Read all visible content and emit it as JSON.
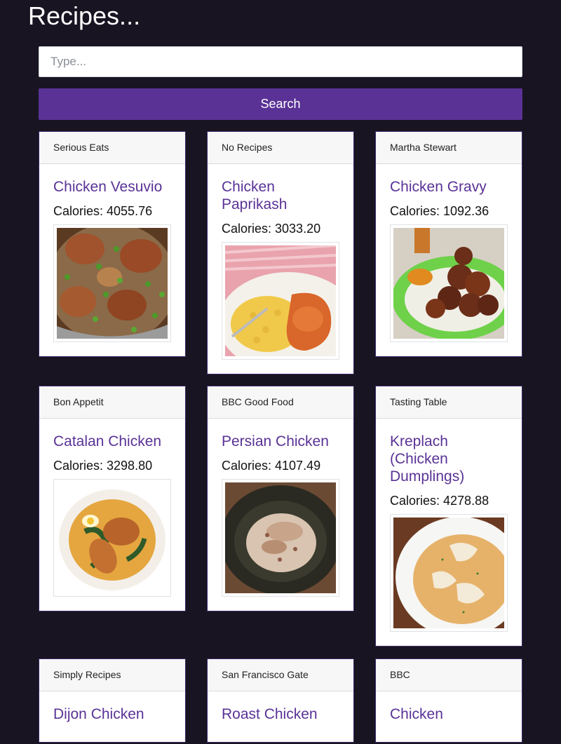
{
  "page": {
    "title": "Recipes..."
  },
  "search": {
    "placeholder": "Type...",
    "value": "",
    "button_label": "Search"
  },
  "cards": [
    {
      "source": "Serious Eats",
      "title": "Chicken Vesuvio",
      "calories": "Calories: 4055.76"
    },
    {
      "source": "No Recipes",
      "title": "Chicken Paprikash",
      "calories": "Calories: 3033.20"
    },
    {
      "source": "Martha Stewart",
      "title": "Chicken Gravy",
      "calories": "Calories: 1092.36"
    },
    {
      "source": "Bon Appetit",
      "title": "Catalan Chicken",
      "calories": "Calories: 3298.80"
    },
    {
      "source": "BBC Good Food",
      "title": "Persian Chicken",
      "calories": "Calories: 4107.49"
    },
    {
      "source": "Tasting Table",
      "title": "Kreplach (Chicken Dumplings)",
      "calories": "Calories: 4278.88"
    },
    {
      "source": "Simply Recipes",
      "title": "Dijon Chicken",
      "calories": ""
    },
    {
      "source": "San Francisco Gate",
      "title": "Roast Chicken",
      "calories": ""
    },
    {
      "source": "BBC",
      "title": "Chicken",
      "calories": ""
    }
  ],
  "colors": {
    "background": "#181421",
    "accent": "#5a3296",
    "card_border": "#3c2a6b"
  }
}
